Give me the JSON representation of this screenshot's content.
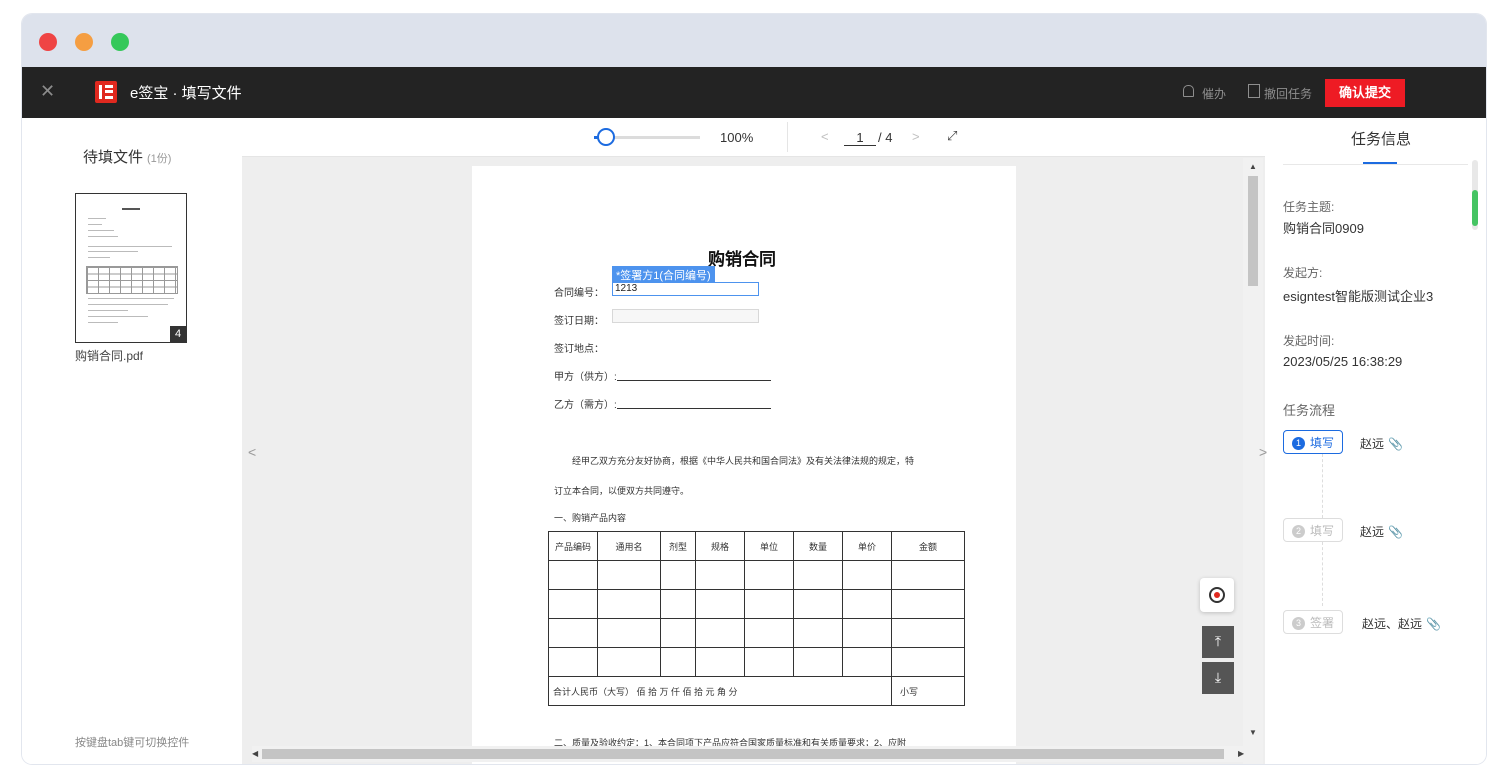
{
  "app": {
    "title": "e签宝 · 填写文件"
  },
  "topbar": {
    "remind_label": "催办",
    "revoke_label": "撤回任务",
    "submit_label": "确认提交"
  },
  "left": {
    "pending_label": "待填文件",
    "pending_count": "(1份)",
    "file_name": "购销合同.pdf",
    "file_pages": "4",
    "hint": "按键盘tab键可切换控件"
  },
  "viewer": {
    "zoom": "100%",
    "zoom_fraction": 0.1,
    "page_current": "1",
    "page_total": "/ 4"
  },
  "document": {
    "title": "购销合同",
    "field_tag": "*签署方1(合同编号)",
    "contract_no_label": "合同编号：",
    "contract_no_value": "1213",
    "sign_date_label": "签订日期：",
    "sign_place_label": "签订地点：",
    "party_a_label": "甲方（供方）:",
    "party_b_label": "乙方（需方）:",
    "para1": "经甲乙双方充分友好协商，根据《中华人民共和国合同法》及有关法律法规的规定，特",
    "para2": "订立本合同，以便双方共同遵守。",
    "section1": "一、购销产品内容",
    "table_headers": [
      "产品编码",
      "通用名",
      "剂型",
      "规格",
      "单位",
      "数量",
      "单价",
      "金额"
    ],
    "total_label": "合计人民币（大写）  佰  拾  万  仟  佰  拾  元  角  分",
    "total_small": "小写",
    "section2": "二、质量及验收约定：1、本合同项下产品应符合国家质量标准和有关质量要求；2、应附"
  },
  "task": {
    "panel_title": "任务信息",
    "subject_label": "任务主题:",
    "subject_value": "购销合同0909",
    "initiator_label": "发起方:",
    "initiator_value": "esigntest智能版测试企业3",
    "time_label": "发起时间:",
    "time_value": "2023/05/25 16:38:29",
    "flow_label": "任务流程",
    "steps": [
      {
        "num": "1",
        "action": "填写",
        "who": "赵远"
      },
      {
        "num": "2",
        "action": "填写",
        "who": "赵远"
      },
      {
        "num": "3",
        "action": "签署",
        "who": "赵远、赵远"
      }
    ]
  },
  "colors": {
    "accent": "#1c6be0",
    "brand_red": "#ee1b24",
    "topbar": "#232323"
  },
  "icons": [
    "close-icon",
    "logo-icon",
    "bell-icon",
    "revoke-icon",
    "expand-icon",
    "locate-icon",
    "to-top-icon",
    "to-bottom-icon",
    "paperclip-icon"
  ]
}
